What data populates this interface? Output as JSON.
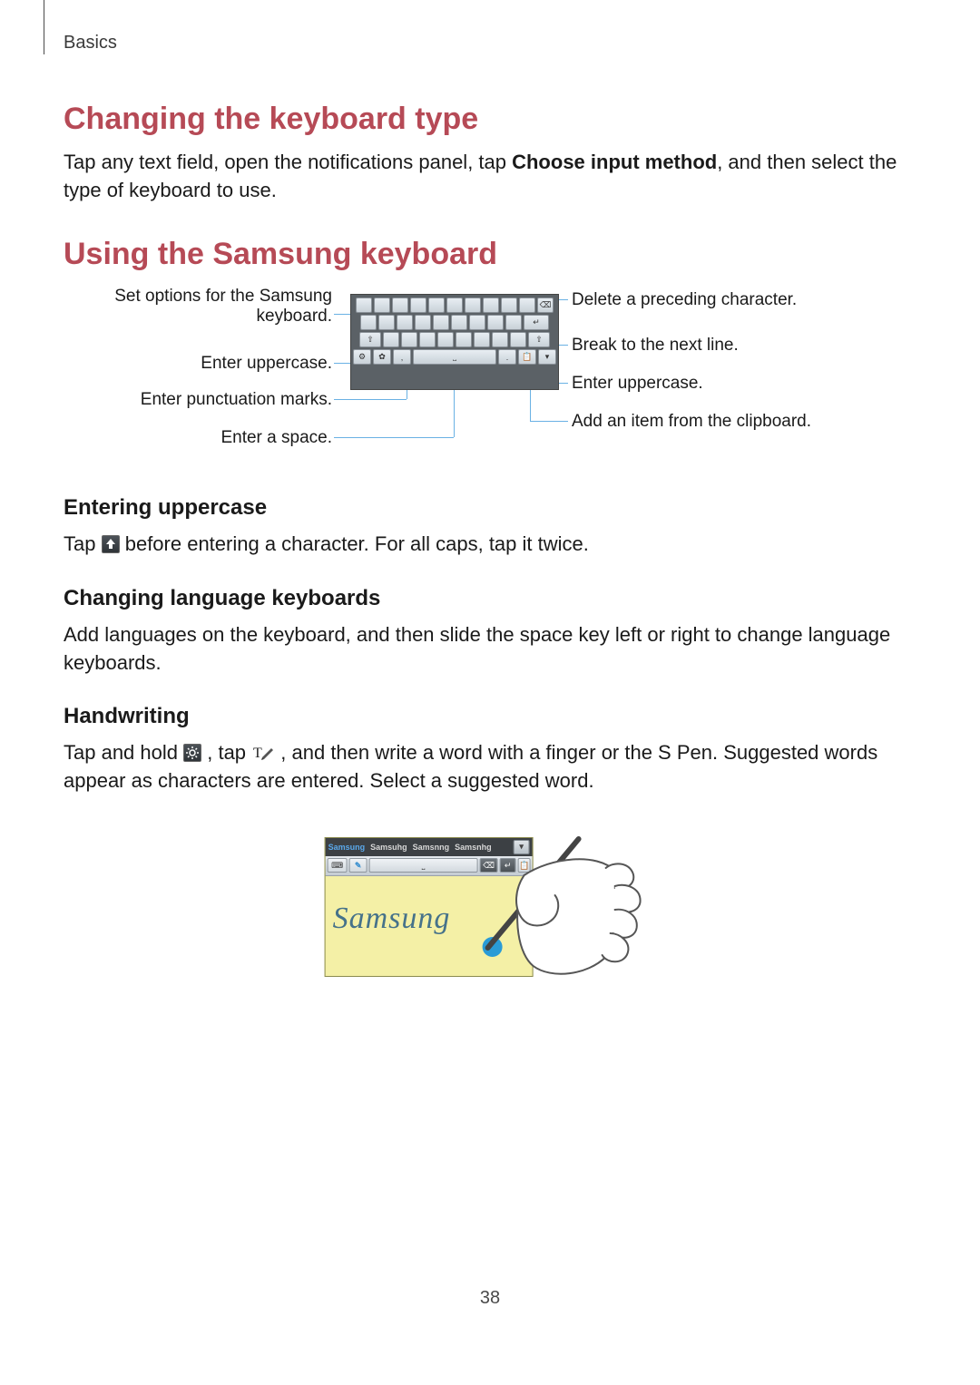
{
  "breadcrumb": "Basics",
  "page_number": "38",
  "section1": {
    "heading": "Changing the keyboard type",
    "para_a": "Tap any text field, open the notifications panel, tap ",
    "para_bold": "Choose input method",
    "para_b": ", and then select the type of keyboard to use."
  },
  "section2": {
    "heading": "Using the Samsung keyboard",
    "callouts_left": {
      "set_options_l1": "Set options for the Samsung",
      "set_options_l2": "keyboard.",
      "uppercase": "Enter uppercase.",
      "punct": "Enter punctuation marks.",
      "space": "Enter a space."
    },
    "callouts_right": {
      "delete": "Delete a preceding character.",
      "break_line": "Break to the next line.",
      "uppercase": "Enter uppercase.",
      "clipboard": "Add an item from the clipboard."
    },
    "sub1": {
      "heading": "Entering uppercase",
      "para_a": "Tap ",
      "para_b": " before entering a character. For all caps, tap it twice."
    },
    "sub2": {
      "heading": "Changing language keyboards",
      "para": "Add languages on the keyboard, and then slide the space key left or right to change language keyboards."
    },
    "sub3": {
      "heading": "Handwriting",
      "para_a": "Tap and hold ",
      "para_b": ", tap ",
      "para_c": " , and then write a word with a finger or the S Pen. Suggested words appear as characters are entered. Select a suggested word."
    }
  },
  "handwriting_figure": {
    "suggestions": [
      "Samsung",
      "Samsuhg",
      "Samsnng",
      "Samsnhg"
    ],
    "written_text": "Samsung"
  }
}
